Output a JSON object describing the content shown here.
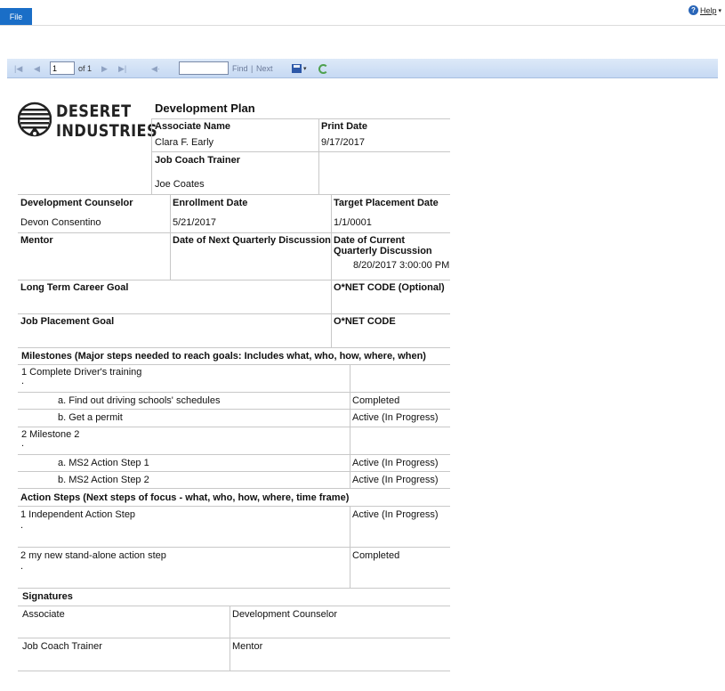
{
  "topbar": {
    "file_label": "File",
    "help_label": "Help",
    "help_icon": "?"
  },
  "toolbar": {
    "page_value": "1",
    "of_label": "of 1",
    "find_label": "Find",
    "separator": "|",
    "next_label": "Next",
    "find_value": ""
  },
  "report": {
    "logo": {
      "line1": "DESERET",
      "line2": "INDUSTRIES"
    },
    "title": "Development Plan",
    "associate_name": {
      "label": "Associate Name",
      "value": "Clara F. Early"
    },
    "print_date": {
      "label": "Print Date",
      "value": "9/17/2017"
    },
    "job_coach_trainer": {
      "label": "Job Coach Trainer",
      "value": "Joe Coates"
    },
    "development_counselor": {
      "label": "Development Counselor",
      "value": "Devon Consentino"
    },
    "enrollment_date": {
      "label": "Enrollment Date",
      "value": "5/21/2017"
    },
    "target_placement_date": {
      "label": "Target Placement Date",
      "value": "1/1/0001"
    },
    "mentor": {
      "label": "Mentor",
      "value": ""
    },
    "next_quarterly": {
      "label": "Date of Next Quarterly Discussion",
      "value": ""
    },
    "current_quarterly": {
      "label_line1": "Date of Current",
      "label_line2": "Quarterly Discussion",
      "value": "8/20/2017 3:00:00 PM"
    },
    "long_term_goal": {
      "label": "Long Term Career Goal",
      "value": ""
    },
    "onet_optional": {
      "label": "O*NET CODE (Optional)",
      "value": ""
    },
    "job_placement_goal": {
      "label": "Job Placement Goal",
      "value": ""
    },
    "onet": {
      "label": "O*NET CODE",
      "value": ""
    },
    "milestones_header": "Milestones (Major steps needed to reach goals: Includes what, who, how, where, when)",
    "milestones": [
      {
        "title": "1 Complete Driver's training",
        "dot": ".",
        "steps": [
          {
            "label": "a. Find out driving schools' schedules",
            "status": "Completed"
          },
          {
            "label": "b. Get a permit",
            "status": "Active (In Progress)"
          }
        ]
      },
      {
        "title": "2 Milestone 2",
        "dot": ".",
        "steps": [
          {
            "label": "a. MS2 Action Step 1",
            "status": "Active (In Progress)"
          },
          {
            "label": "b. MS2 Action Step 2",
            "status": "Active (In Progress)"
          }
        ]
      }
    ],
    "action_steps_header": "Action Steps (Next steps of focus -  what, who, how, where, time frame)",
    "action_steps": [
      {
        "title": "1 Independent Action Step",
        "dot": ".",
        "status": "Active (In Progress)"
      },
      {
        "title": "2 my new stand-alone action step",
        "dot": ".",
        "status": "Completed"
      }
    ],
    "signatures": {
      "header": "Signatures",
      "associate": "Associate",
      "development_counselor": "Development Counselor",
      "job_coach_trainer": "Job Coach Trainer",
      "mentor": "Mentor"
    }
  }
}
